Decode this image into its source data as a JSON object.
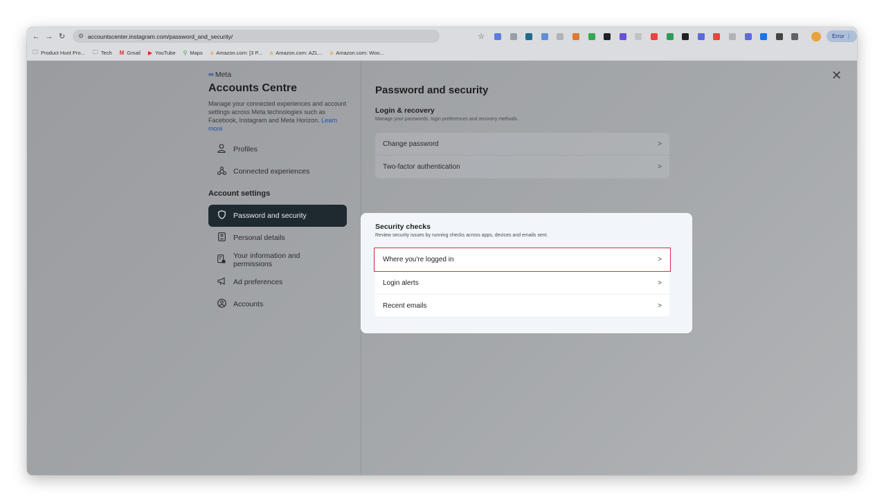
{
  "browser": {
    "url": "accountscenter.instagram.com/password_and_security/",
    "error_label": "Error",
    "ext_colors": [
      "#5b7de0",
      "#9aa0a6",
      "#1c6e8c",
      "#5f8fd8",
      "#b0b3b8",
      "#e07a2e",
      "#34a853",
      "#202124",
      "#6b4fd8",
      "#c0c4c8",
      "#e8453c",
      "#2e9b57",
      "#202124",
      "#5f6ad8",
      "#e8453c",
      "#b0b3b8",
      "#5f6ad8",
      "#1a73e8",
      "#444",
      "#5f6368"
    ]
  },
  "bookmarks": [
    {
      "icon": "folder-icon",
      "label": "Product Hunt Pro..."
    },
    {
      "icon": "folder-icon",
      "label": "Tech"
    },
    {
      "icon": "gmail-icon",
      "label": "Gmail"
    },
    {
      "icon": "youtube-icon",
      "label": "YouTube"
    },
    {
      "icon": "maps-icon",
      "label": "Maps"
    },
    {
      "icon": "amazon-icon",
      "label": "Amazon.com: [3 P..."
    },
    {
      "icon": "amazon-icon",
      "label": "Amazon.com: AZL..."
    },
    {
      "icon": "amazon-icon",
      "label": "Amazon.com: Woo..."
    }
  ],
  "sidebar": {
    "brand": "Meta",
    "title": "Accounts Centre",
    "description": "Manage your connected experiences and account settings across Meta technologies such as Facebook, Instagram and Meta Horizon.",
    "learn_more": "Learn more",
    "top_items": [
      {
        "label": "Profiles"
      },
      {
        "label": "Connected experiences"
      }
    ],
    "section_label": "Account settings",
    "settings_items": [
      {
        "label": "Password and security"
      },
      {
        "label": "Personal details"
      },
      {
        "label": "Your information and permissions"
      },
      {
        "label": "Ad preferences"
      },
      {
        "label": "Accounts"
      }
    ]
  },
  "main": {
    "title": "Password and security",
    "login_recovery": {
      "title": "Login & recovery",
      "subtitle": "Manage your passwords, login preferences and recovery methods.",
      "items": [
        {
          "label": "Change password"
        },
        {
          "label": "Two-factor authentication"
        }
      ]
    },
    "security_checks": {
      "title": "Security checks",
      "subtitle": "Review security issues by running checks across apps, devices and emails sent.",
      "items": [
        {
          "label": "Where you're logged in"
        },
        {
          "label": "Login alerts"
        },
        {
          "label": "Recent emails"
        }
      ]
    }
  },
  "chevron": ">"
}
